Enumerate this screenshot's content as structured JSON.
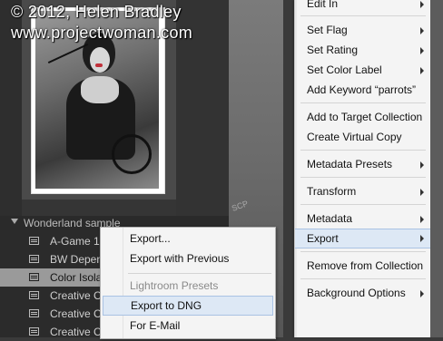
{
  "watermark": {
    "line1": "© 2012, Helen Bradley",
    "line2": "www.projectwoman.com"
  },
  "panel": {
    "folder_name": "Wonderland sample",
    "collections": [
      {
        "label": "A-Game 1",
        "selected": false
      },
      {
        "label": "BW Depen",
        "selected": false
      },
      {
        "label": "Color Isola",
        "selected": true
      },
      {
        "label": "Creative C",
        "selected": false
      },
      {
        "label": "Creative C",
        "selected": false
      },
      {
        "label": "Creative C",
        "selected": false
      }
    ]
  },
  "watermark_photo": {
    "mark": "SCP"
  },
  "context_menu": {
    "items": [
      {
        "label": "Edit In",
        "has_submenu": true
      },
      {
        "label": "Set Flag",
        "has_submenu": true
      },
      {
        "label": "Set Rating",
        "has_submenu": true
      },
      {
        "label": "Set Color Label",
        "has_submenu": true
      },
      {
        "label": "Add Keyword “parrots”",
        "has_submenu": false
      },
      {
        "label": "Add to Target Collection",
        "has_submenu": false
      },
      {
        "label": "Create Virtual Copy",
        "has_submenu": false
      },
      {
        "label": "Metadata Presets",
        "has_submenu": true
      },
      {
        "label": "Transform",
        "has_submenu": true
      },
      {
        "label": "Metadata",
        "has_submenu": true
      },
      {
        "label": "Export",
        "has_submenu": true,
        "highlighted": true
      },
      {
        "label": "Remove from Collection",
        "has_submenu": false
      },
      {
        "label": "Background Options",
        "has_submenu": true
      }
    ]
  },
  "export_submenu": {
    "export_label": "Export...",
    "export_previous_label": "Export with Previous",
    "presets_header": "Lightroom Presets",
    "export_dng_label": "Export to DNG",
    "email_label": "For E-Mail"
  },
  "colors": {
    "menu_bg": "#f4f4f4",
    "highlight": "#dde8f5",
    "highlight_border": "#a9c2e3",
    "panel_bg": "#2b2b2b",
    "selected_row": "#9a9a9a"
  }
}
